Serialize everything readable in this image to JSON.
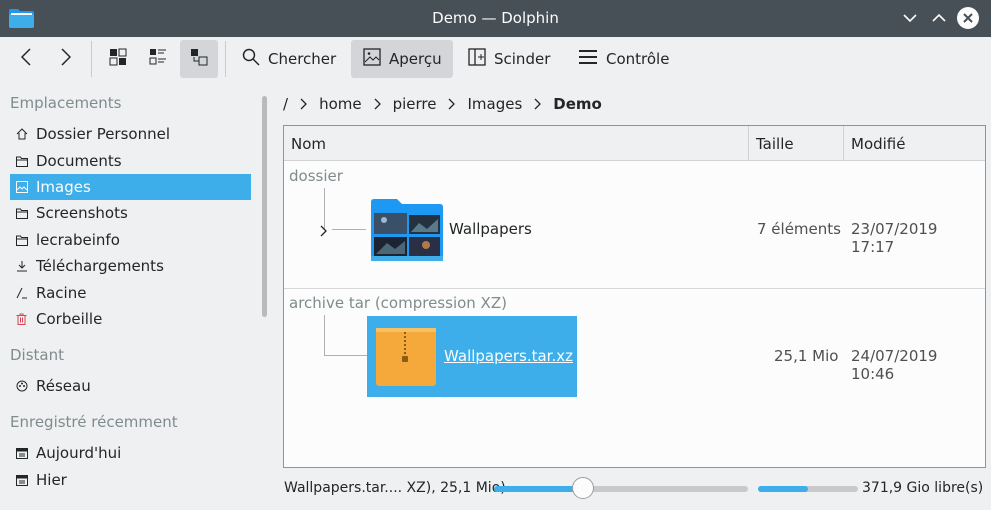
{
  "window": {
    "title": "Demo — Dolphin"
  },
  "toolbar": {
    "search_label": "Chercher",
    "preview_label": "Aperçu",
    "split_label": "Scinder",
    "control_label": "Contrôle"
  },
  "sidebar": {
    "places_title": "Emplacements",
    "places": [
      {
        "label": "Dossier Personnel",
        "icon": "home-icon"
      },
      {
        "label": "Documents",
        "icon": "folder-icon"
      },
      {
        "label": "Images",
        "icon": "image-icon",
        "selected": true
      },
      {
        "label": "Screenshots",
        "icon": "folder-icon"
      },
      {
        "label": "lecrabeinfo",
        "icon": "folder-icon"
      },
      {
        "label": "Téléchargements",
        "icon": "download-icon"
      },
      {
        "label": "Racine",
        "icon": "root-icon"
      },
      {
        "label": "Corbeille",
        "icon": "trash-icon"
      }
    ],
    "remote_title": "Distant",
    "remote": [
      {
        "label": "Réseau",
        "icon": "network-icon"
      }
    ],
    "recent_title": "Enregistré récemment",
    "recent": [
      {
        "label": "Aujourd'hui",
        "icon": "calendar-icon"
      },
      {
        "label": "Hier",
        "icon": "calendar-icon"
      }
    ]
  },
  "breadcrumb": [
    "/",
    "home",
    "pierre",
    "Images",
    "Demo"
  ],
  "columns": {
    "name": "Nom",
    "size": "Taille",
    "modified": "Modifié"
  },
  "groups": [
    {
      "title": "dossier",
      "items": [
        {
          "name": "Wallpapers",
          "size": "7 éléments",
          "modified": "23/07/2019 17:17"
        }
      ]
    },
    {
      "title": "archive tar (compression XZ)",
      "items": [
        {
          "name": "Wallpapers.tar.xz",
          "size": "25,1 Mio",
          "modified": "24/07/2019 10:46",
          "selected": true
        }
      ]
    }
  ],
  "statusbar": {
    "selection_text": "Wallpapers.tar.... XZ), 25,1 Mio)",
    "zoom_level": 0.35,
    "used_space_fraction": 0.5,
    "free_space": "371,9 Gio libre(s)"
  },
  "colors": {
    "accent": "#3daee9",
    "titlebar": "#475057",
    "archive": "#f5a93a"
  }
}
